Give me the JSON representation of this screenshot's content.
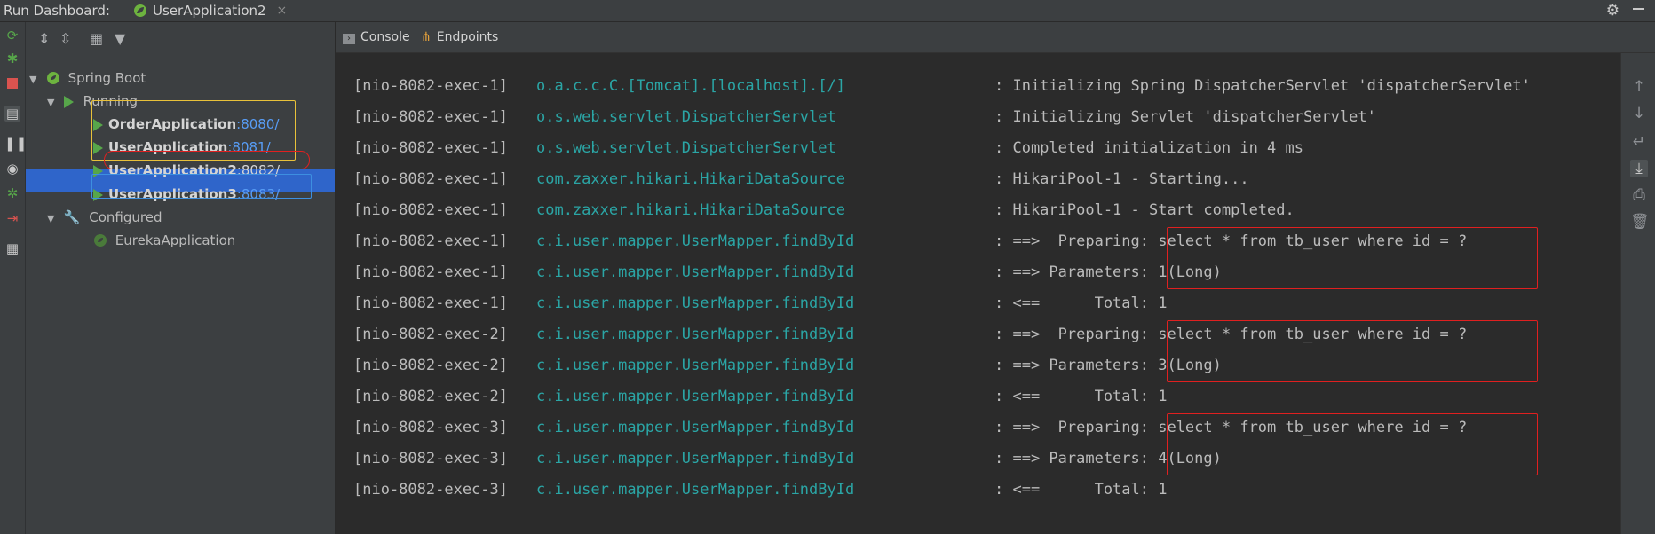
{
  "window": {
    "title": "Run Dashboard:",
    "active_tab": "UserApplication2",
    "close_symbol": "×"
  },
  "tree": {
    "root": "Spring Boot",
    "running_group": "Running",
    "running_apps": [
      {
        "name": "OrderApplication",
        "port": ":8080/"
      },
      {
        "name": "UserApplication",
        "port": ":8081/"
      },
      {
        "name": "UserApplication2",
        "port": ":8082/"
      },
      {
        "name": "UserApplication3",
        "port": ":8083/"
      }
    ],
    "configured_group": "Configured",
    "configured_apps": [
      "EurekaApplication"
    ]
  },
  "tabs": {
    "console": "Console",
    "endpoints": "Endpoints"
  },
  "console": {
    "lines": [
      {
        "thread": "[nio-8082-exec-1]",
        "logger": "o.a.c.c.C.[Tomcat].[localhost].[/]",
        "message": ": Initializing Spring DispatcherServlet 'dispatcherServlet'"
      },
      {
        "thread": "[nio-8082-exec-1]",
        "logger": "o.s.web.servlet.DispatcherServlet",
        "message": ": Initializing Servlet 'dispatcherServlet'"
      },
      {
        "thread": "[nio-8082-exec-1]",
        "logger": "o.s.web.servlet.DispatcherServlet",
        "message": ": Completed initialization in 4 ms"
      },
      {
        "thread": "[nio-8082-exec-1]",
        "logger": "com.zaxxer.hikari.HikariDataSource",
        "message": ": HikariPool-1 - Starting..."
      },
      {
        "thread": "[nio-8082-exec-1]",
        "logger": "com.zaxxer.hikari.HikariDataSource",
        "message": ": HikariPool-1 - Start completed."
      },
      {
        "thread": "[nio-8082-exec-1]",
        "logger": "c.i.user.mapper.UserMapper.findById",
        "message": ": ==>  Preparing: select * from tb_user where id = ?"
      },
      {
        "thread": "[nio-8082-exec-1]",
        "logger": "c.i.user.mapper.UserMapper.findById",
        "message": ": ==> Parameters: 1(Long)"
      },
      {
        "thread": "[nio-8082-exec-1]",
        "logger": "c.i.user.mapper.UserMapper.findById",
        "message": ": <==      Total: 1"
      },
      {
        "thread": "[nio-8082-exec-2]",
        "logger": "c.i.user.mapper.UserMapper.findById",
        "message": ": ==>  Preparing: select * from tb_user where id = ?"
      },
      {
        "thread": "[nio-8082-exec-2]",
        "logger": "c.i.user.mapper.UserMapper.findById",
        "message": ": ==> Parameters: 3(Long)"
      },
      {
        "thread": "[nio-8082-exec-2]",
        "logger": "c.i.user.mapper.UserMapper.findById",
        "message": ": <==      Total: 1"
      },
      {
        "thread": "[nio-8082-exec-3]",
        "logger": "c.i.user.mapper.UserMapper.findById",
        "message": ": ==>  Preparing: select * from tb_user where id = ?"
      },
      {
        "thread": "[nio-8082-exec-3]",
        "logger": "c.i.user.mapper.UserMapper.findById",
        "message": ": ==> Parameters: 4(Long)"
      },
      {
        "thread": "[nio-8082-exec-3]",
        "logger": "c.i.user.mapper.UserMapper.findById",
        "message": ": <==      Total: 1"
      }
    ]
  },
  "colors": {
    "logger": "#2ba5a5",
    "port_link": "#589df6",
    "run_green": "#57a64a",
    "selection": "#2f65ca",
    "highlight_red": "#e02020",
    "highlight_yellow": "#e8c13a",
    "highlight_blue": "#3d8fe0"
  }
}
